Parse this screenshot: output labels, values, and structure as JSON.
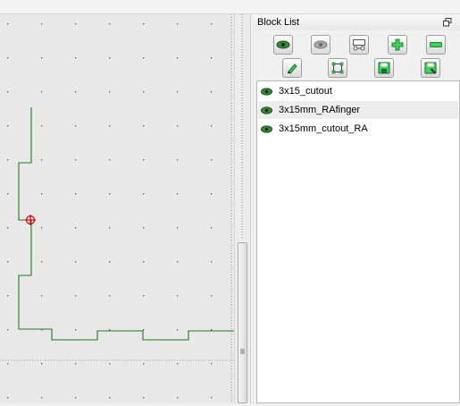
{
  "dock": {
    "title": "Block List",
    "float_icon": "dock-float-icon",
    "toolbar": [
      {
        "name": "show-all-blocks-button",
        "icon": "eye-icon"
      },
      {
        "name": "hide-all-blocks-button",
        "icon": "eye-hidden-icon"
      },
      {
        "name": "create-block-button",
        "icon": "block-create-icon"
      },
      {
        "name": "add-block-button",
        "icon": "plus-icon"
      },
      {
        "name": "remove-block-button",
        "icon": "minus-icon"
      },
      {
        "name": "edit-block-button",
        "icon": "pencil-icon"
      },
      {
        "name": "insert-block-button",
        "icon": "insert-block-icon"
      },
      {
        "name": "save-block-button",
        "icon": "save-icon"
      },
      {
        "name": "save-block-as-button",
        "icon": "save-as-icon"
      }
    ],
    "blocks": [
      {
        "label": "3x15_cutout",
        "visible": true,
        "selected": false
      },
      {
        "label": "3x15mm_RAfinger",
        "visible": true,
        "selected": true
      },
      {
        "label": "3x15mm_cutout_RA",
        "visible": true,
        "selected": false
      }
    ]
  },
  "canvas": {
    "background": "#e8e8e8",
    "entity_color": "#1e7a1e",
    "marker_color": "#cc0000",
    "marker_icon": "crosshair-target-icon"
  },
  "scrollbar": {
    "grip_icon": "scroll-grip-icon"
  }
}
